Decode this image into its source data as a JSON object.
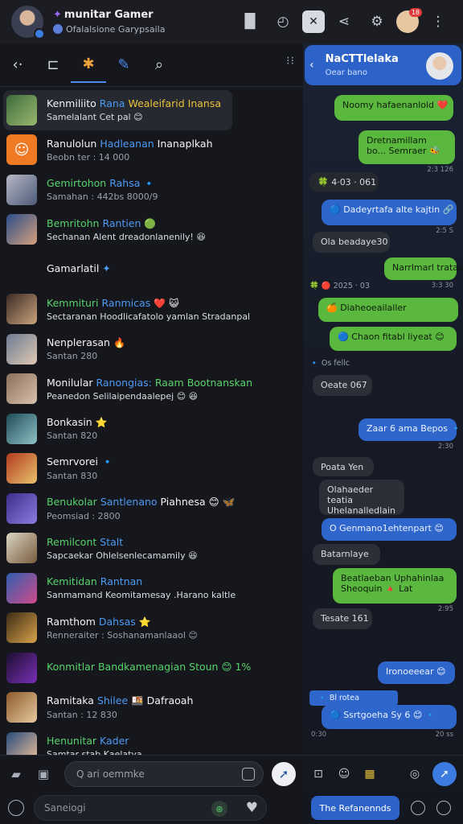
{
  "header": {
    "title_prefix": "✦",
    "title": "munitar Gamer",
    "subtitle": "Ofalalsione Garypsaila",
    "icons": [
      "book-icon",
      "clock-icon",
      "close-icon",
      "share-icon",
      "settings-icon",
      "profile-icon",
      "more-icon"
    ],
    "notification_count": "18"
  },
  "toolbar": {
    "back": "‹·",
    "icons": [
      "back-icon",
      "bookmark-icon",
      "apps-icon",
      "edit-icon",
      "search-icon"
    ],
    "more": "⁝⁝"
  },
  "conversations": [
    {
      "name_a": "Kenmiliito",
      "name_b": "Rana",
      "name_c": "Wealeifarid Inansa",
      "preview": "Samelalant Cet pal 😊",
      "name_color": "white"
    },
    {
      "name_a": "Ranulolun",
      "name_b": "Hadleanan",
      "name_c": "Inanaplkah",
      "preview": "Beobn ter : 14 000",
      "name_color": "white"
    },
    {
      "name_a": "Gemirtohon",
      "name_b": "Rahsa",
      "name_c": "🔹",
      "preview": "Samahan : 442bs 8000/9",
      "name_color": "green"
    },
    {
      "name_a": "Bemritohn",
      "name_b": "Rantien",
      "name_c": "🟢",
      "preview": "Sechanan Alent dreadonlanenily! 😆",
      "name_color": "green"
    },
    {
      "name_a": "Gamarlatil",
      "name_b": "",
      "name_c": "✦",
      "preview": "",
      "name_color": "white"
    },
    {
      "name_a": "Kemmituri",
      "name_b": "Ranmicas",
      "name_c": "❤️ 😺",
      "preview": "Sectaranan Hoodlicafatolo yamlan Stradanpal",
      "name_color": "green"
    },
    {
      "name_a": "Nenplerasan",
      "name_b": "",
      "name_c": "🔥",
      "preview": "Santan 280",
      "name_color": "white"
    },
    {
      "name_a": "Monilular",
      "name_b": "Ranongias:",
      "name_c": "Raam Bootnanskan",
      "preview": "Peanedon Selilaipendaalepej 😊 😆",
      "name_color": "white"
    },
    {
      "name_a": "Bonkasin",
      "name_b": "",
      "name_c": "⭐",
      "preview": "Santan 820",
      "name_color": "white"
    },
    {
      "name_a": "Semrvorei",
      "name_b": "",
      "name_c": "🔹",
      "preview": "Santan 830",
      "name_color": "white"
    },
    {
      "name_a": "Benukolar",
      "name_b": "Santlenano",
      "name_c": "Piahnesa 😊 🦋",
      "preview": "Peomsiad : 2800",
      "name_color": "green"
    },
    {
      "name_a": "Remilcont",
      "name_b": "Stalt",
      "name_c": "",
      "preview": "Sapcaekar Ohlelsenlecamamily 😆",
      "name_color": "green"
    },
    {
      "name_a": "Kemitidan",
      "name_b": "Rantnan",
      "name_c": "",
      "preview": "Sanmamand Keomitamesay .Harano kaltle",
      "name_color": "green"
    },
    {
      "name_a": "Ramthom",
      "name_b": "Dahsas",
      "name_c": "⭐",
      "preview": "Renneraiter : Soshanamanlaaol 😊",
      "name_color": "white"
    },
    {
      "name_a": "Konmitlar",
      "name_b": "Bandkamenagian",
      "name_c": "Stoun 😊 1%",
      "preview": "",
      "name_color": "green"
    },
    {
      "name_a": "Ramitaka",
      "name_b": "Shilee",
      "name_c": "🍱 Dafraoah",
      "preview": "Santan : 12 830",
      "name_color": "white"
    },
    {
      "name_a": "Henunitar",
      "name_b": "Kader",
      "name_c": "",
      "preview": "Samtar stab Kaelatya",
      "name_color": "green"
    }
  ],
  "left_bottom": {
    "search_placeholder": "Q ari oemmke",
    "status_placeholder": "Saneiogi",
    "page_hint": "⊕"
  },
  "chat": {
    "contact_name": "NaCTTlelaka",
    "contact_status": "Oear bano",
    "messages": [
      {
        "text": "Noomy hafaenanlold ❤️",
        "type": "out",
        "time": ""
      },
      {
        "text": "Dretnamillam bo... Semraer 🐝",
        "type": "out",
        "time": "2:3 126"
      },
      {
        "text": "🍀 4·03 · 061",
        "type": "sys",
        "time": ""
      },
      {
        "text": "🔵 Dadeyrtafa alte kajtin 🔗",
        "type": "blue",
        "time": "2:5 S"
      },
      {
        "text": "Ola beadaye30",
        "type": "in",
        "time": ""
      },
      {
        "text": "Narrlmarl tratas",
        "type": "out",
        "time": "3:3 30"
      },
      {
        "text": "🍀 🔴 2025 · 03",
        "type": "sys",
        "time": ""
      },
      {
        "text": "🍊 Diaheoeailaller",
        "type": "out",
        "time": ""
      },
      {
        "text": "🔵 Chaon fitabl liyeat 😊",
        "type": "out",
        "time": ""
      },
      {
        "text": "🔹 Os fellc",
        "type": "sys",
        "time": ""
      },
      {
        "text": "Oeate 067",
        "type": "in",
        "time": ""
      },
      {
        "text": "Zaar 6 ama Bepos 🔹",
        "type": "blue",
        "time": "2:30"
      },
      {
        "text": "Poata Yen",
        "type": "in",
        "time": ""
      },
      {
        "text": "Olahaeder teatia Uhelanalledlain",
        "type": "in",
        "time": ""
      },
      {
        "text": "O Genmano1ehtenpart 😊",
        "type": "blue",
        "time": ""
      },
      {
        "text": "Batarnlaye",
        "type": "in",
        "time": ""
      },
      {
        "text": "Beatlaeban Uphahinlaa Sheoquin 🔺 Lat",
        "type": "out",
        "time": "2:95"
      },
      {
        "text": "Tesate 161",
        "type": "in",
        "time": ""
      },
      {
        "text": "Ironoeeear 😊",
        "type": "blue",
        "time": ""
      },
      {
        "text": "🔹 Bl rotea",
        "type": "sys",
        "time": ""
      },
      {
        "text": "🔵 Ssrtgoeha Sy 6 😊 🔹",
        "type": "blue",
        "time": "20 ss"
      }
    ],
    "footer_time": "0:30",
    "button_label": "The Refanennds"
  }
}
